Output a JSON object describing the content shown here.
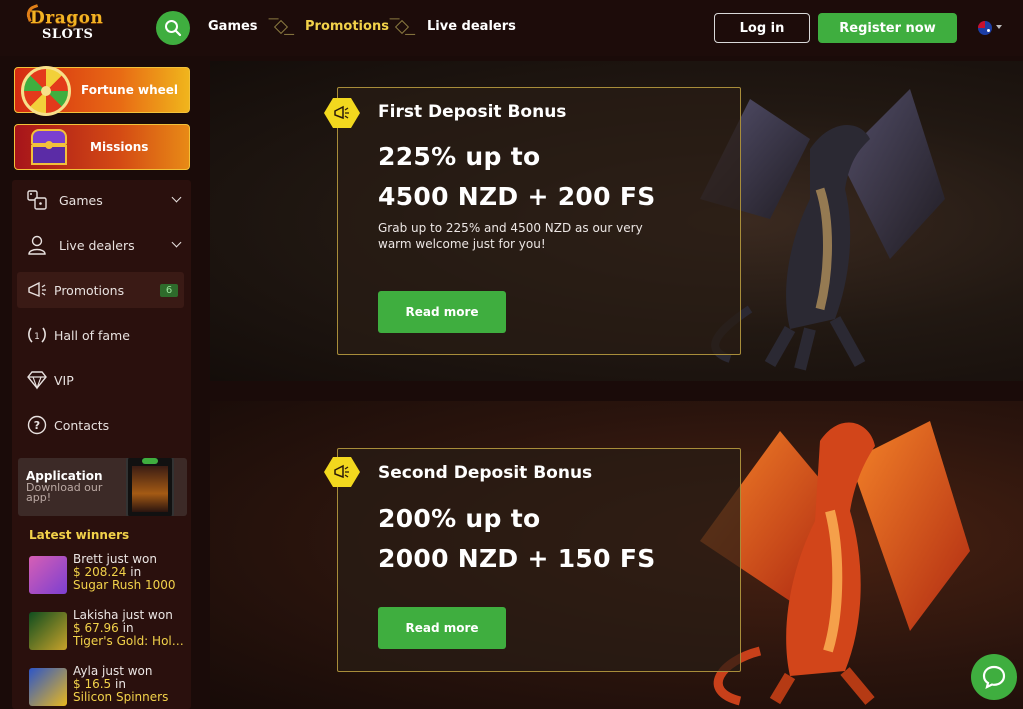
{
  "brand": {
    "logo_line1": "Dragon",
    "logo_line2": "SLOTS"
  },
  "header": {
    "nav": [
      {
        "label": "Games"
      },
      {
        "label": "Promotions"
      },
      {
        "label": "Live dealers"
      }
    ],
    "login_label": "Log in",
    "register_label": "Register now",
    "language_flag": "new-zealand-flag-icon"
  },
  "sidebar": {
    "fortune_wheel": "Fortune wheel",
    "missions": "Missions",
    "items": [
      {
        "label": "Games",
        "icon": "games-icon",
        "expandable": true
      },
      {
        "label": "Live dealers",
        "icon": "live-dealer-icon",
        "expandable": true
      },
      {
        "label": "Promotions",
        "icon": "megaphone-icon",
        "badge": "6",
        "active": true
      },
      {
        "label": "Hall of fame",
        "icon": "laurel-icon"
      },
      {
        "label": "VIP",
        "icon": "diamond-icon"
      },
      {
        "label": "Contacts",
        "icon": "question-icon"
      }
    ],
    "app": {
      "title": "Application",
      "subtitle": "Download our app!"
    },
    "winners_title": "Latest winners",
    "winners": [
      {
        "who": "Brett just won",
        "amount": "$ 208.24",
        "in": "in",
        "game": "Sugar Rush 1000"
      },
      {
        "who": "Lakisha just won",
        "amount": "$ 67.96",
        "in": "in",
        "game": "Tiger's Gold: Hold and Win"
      },
      {
        "who": "Ayla just won",
        "amount": "$ 16.5",
        "in": "in",
        "game": "Silicon Spinners"
      }
    ]
  },
  "banners": [
    {
      "title": "First Deposit Bonus",
      "line1": "225% up to",
      "line2": "4500 NZD + 200 FS",
      "description": "Grab up to 225% and 4500 NZD as our very warm welcome just for you!",
      "button": "Read more"
    },
    {
      "title": "Second Deposit Bonus",
      "line1": "200% up to",
      "line2": "2000 NZD + 150 FS",
      "button": "Read more"
    }
  ],
  "colors": {
    "accent_green": "#3fae3f",
    "gold": "#f2d24a",
    "background": "#1a0b09"
  }
}
